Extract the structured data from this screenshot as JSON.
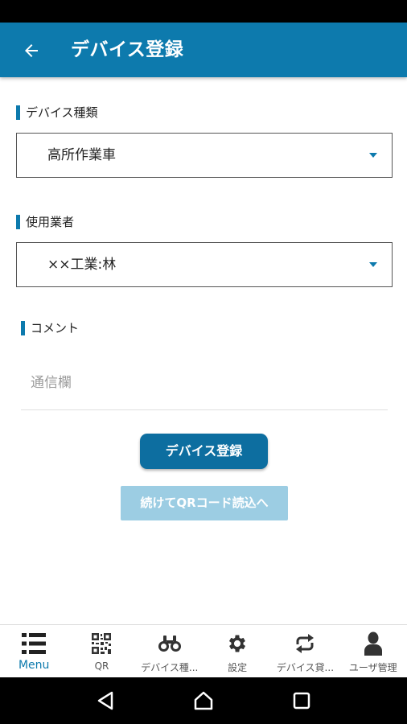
{
  "app_bar": {
    "title": "デバイス登録",
    "back_icon": "arrow-left-icon"
  },
  "form": {
    "device_type": {
      "label": "デバイス種類",
      "value": "高所作業車"
    },
    "user_company": {
      "label": "使用業者",
      "value": "××工業:林"
    },
    "comment": {
      "label": "コメント",
      "placeholder": "通信欄",
      "value": ""
    },
    "register_button": "デバイス登録",
    "continue_qr_button": "続けてQRコード読込へ"
  },
  "bottom_nav": {
    "items": [
      {
        "label": "Menu",
        "icon": "menu-list-icon",
        "active": true
      },
      {
        "label": "QR",
        "icon": "qr-code-icon",
        "active": false
      },
      {
        "label": "デバイス種...",
        "icon": "binoculars-icon",
        "active": false
      },
      {
        "label": "設定",
        "icon": "gear-icon",
        "active": false
      },
      {
        "label": "デバイス貸...",
        "icon": "swap-icon",
        "active": false
      },
      {
        "label": "ユーザ管理",
        "icon": "person-icon",
        "active": false
      }
    ]
  },
  "colors": {
    "primary": "#0d7aad",
    "primary_button": "#0d6ea0",
    "disabled_button": "#9ccde3"
  }
}
